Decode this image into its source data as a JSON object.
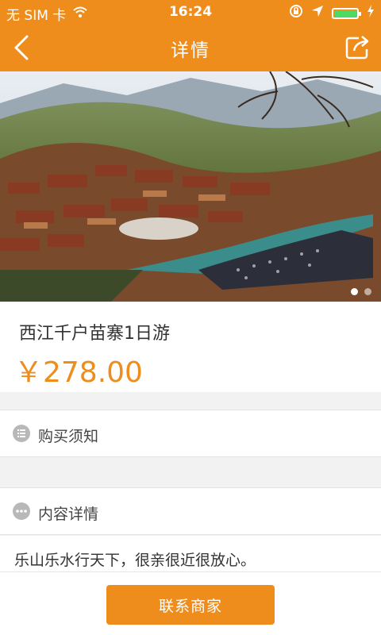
{
  "status_bar": {
    "carrier": "无 SIM 卡",
    "time": "16:24",
    "battery_level": 1.0,
    "icons": [
      "wifi-icon",
      "rotation-lock-icon",
      "location-arrow-icon",
      "battery-icon",
      "charging-icon"
    ]
  },
  "nav": {
    "title": "详情",
    "back_icon": "back-chevron-icon",
    "share_icon": "share-icon"
  },
  "banner": {
    "slide_count": 2,
    "active_slide": 1
  },
  "product": {
    "title": "西江千户苗寨1日游",
    "price": "￥278.00"
  },
  "sections": {
    "purchase_notes": {
      "label": "购买须知",
      "icon": "list-icon"
    },
    "content_details": {
      "label": "内容详情",
      "icon": "more-icon"
    }
  },
  "content": {
    "text": "乐山乐水行天下，很亲很近很放心。"
  },
  "footer": {
    "contact_label": "联系商家"
  },
  "colors": {
    "accent": "#ef8d1c",
    "background": "#f2f2f2",
    "battery": "#4cd964"
  }
}
